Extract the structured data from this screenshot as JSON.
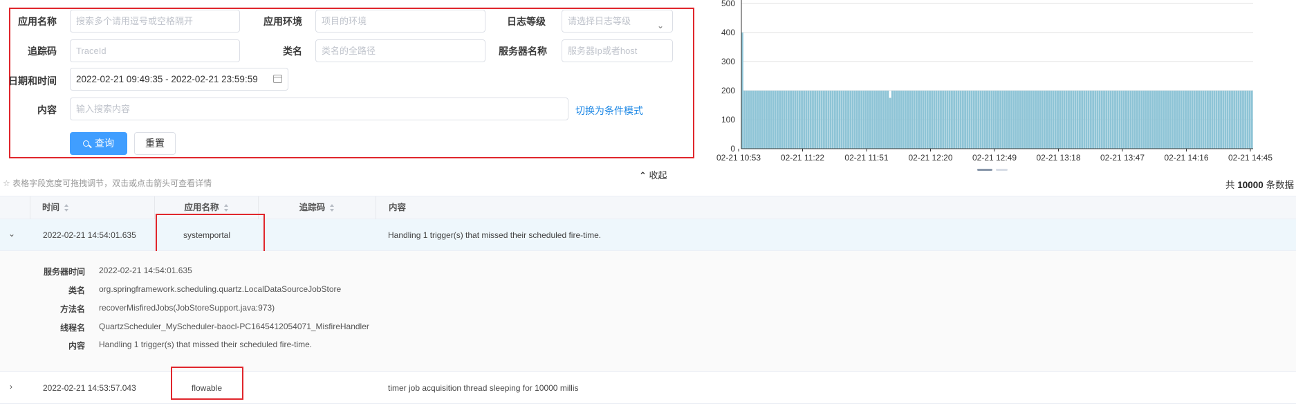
{
  "search": {
    "app_name": {
      "label": "应用名称",
      "placeholder": "搜索多个请用逗号或空格隔开"
    },
    "app_env": {
      "label": "应用环境",
      "placeholder": "项目的环境"
    },
    "log_level": {
      "label": "日志等级",
      "placeholder": "请选择日志等级"
    },
    "trace": {
      "label": "追踪码",
      "placeholder": "TraceId"
    },
    "class_name": {
      "label": "类名",
      "placeholder": "类名的全路径"
    },
    "server_name": {
      "label": "服务器名称",
      "placeholder": "服务器Ip或者host"
    },
    "datetime": {
      "label": "日期和时间",
      "value": "2022-02-21 09:49:35 - 2022-02-21 23:59:59"
    },
    "content": {
      "label": "内容",
      "placeholder": "输入搜索内容"
    },
    "switch_mode_link": "切换为条件模式",
    "query_button": "查询",
    "reset_button": "重置"
  },
  "chart_data": {
    "type": "bar",
    "y_ticks": [
      0,
      100,
      200,
      300,
      400,
      500
    ],
    "ylim": [
      0,
      500
    ],
    "x_tick_labels": [
      "02-21 10:53",
      "02-21 11:22",
      "02-21 11:51",
      "02-21 12:20",
      "02-21 12:49",
      "02-21 13:18",
      "02-21 13:47",
      "02-21 14:16",
      "02-21 14:45"
    ],
    "bar_count": 232,
    "values_description_series": {
      "first_value": 400,
      "typical_value": 200,
      "dip_index": 67,
      "dip_value": 175
    },
    "bar_color": "#8ec4d6"
  },
  "table": {
    "hint": "☆ 表格字段宽度可拖拽调节，双击或点击箭头可查看详情",
    "collapse_label": "收起",
    "total_prefix": "共",
    "total_count": "10000",
    "total_suffix": "条数据",
    "columns": {
      "time": "时间",
      "app": "应用名称",
      "trace": "追踪码",
      "content": "内容"
    },
    "rows": [
      {
        "time": "2022-02-21 14:54:01.635",
        "app": "systemportal",
        "trace": "",
        "content": "Handling 1 trigger(s) that missed their scheduled fire-time."
      },
      {
        "time": "2022-02-21 14:53:57.043",
        "app": "flowable",
        "trace": "",
        "content": "timer job acquisition thread sleeping for 10000 millis"
      }
    ],
    "detail": {
      "server_time": {
        "label": "服务器时间",
        "value": "2022-02-21 14:54:01.635"
      },
      "class_name": {
        "label": "类名",
        "value": "org.springframework.scheduling.quartz.LocalDataSourceJobStore"
      },
      "method": {
        "label": "方法名",
        "value": "recoverMisfiredJobs(JobStoreSupport.java:973)"
      },
      "thread": {
        "label": "线程名",
        "value": "QuartzScheduler_MyScheduler-baocl-PC1645412054071_MisfireHandler"
      },
      "content": {
        "label": "内容",
        "value": "Handling 1 trigger(s) that missed their scheduled fire-time."
      }
    }
  }
}
